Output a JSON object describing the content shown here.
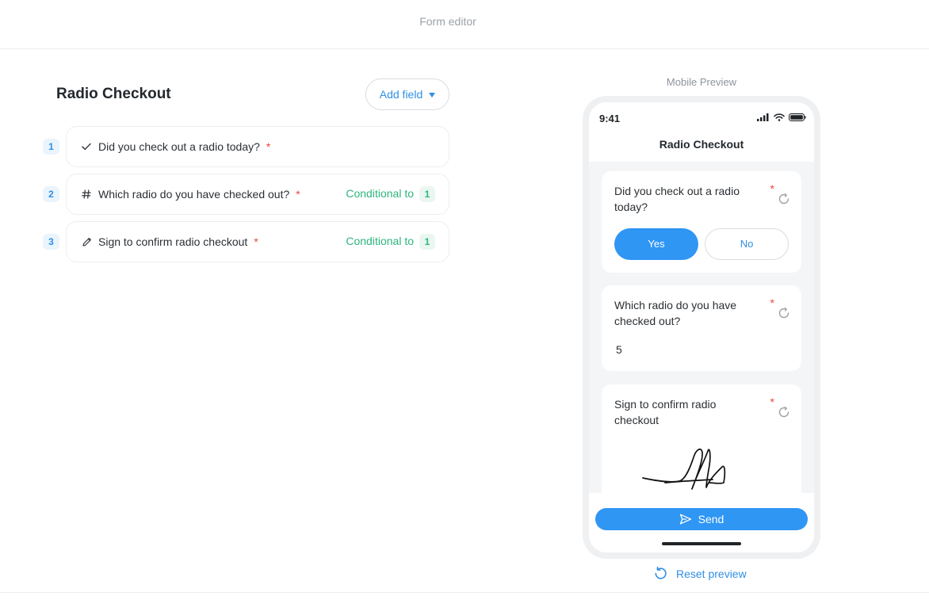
{
  "header": {
    "title": "Form editor"
  },
  "editor": {
    "form_title": "Radio Checkout",
    "add_field_label": "Add field",
    "fields": [
      {
        "number": "1",
        "icon": "check-icon",
        "label": "Did you check out a radio today?",
        "required": "*",
        "conditional_label": "",
        "conditional_to": ""
      },
      {
        "number": "2",
        "icon": "hash-icon",
        "label": "Which radio do you have checked out?",
        "required": "*",
        "conditional_label": "Conditional to",
        "conditional_to": "1"
      },
      {
        "number": "3",
        "icon": "pencil-icon",
        "label": "Sign to confirm radio checkout",
        "required": "*",
        "conditional_label": "Conditional to",
        "conditional_to": "1"
      }
    ]
  },
  "preview": {
    "label": "Mobile Preview",
    "status_time": "9:41",
    "app_title": "Radio Checkout",
    "q1": {
      "text": "Did you check out a radio today?",
      "required": "*",
      "yes": "Yes",
      "no": "No",
      "selected": "Yes"
    },
    "q2": {
      "text": "Which radio do you have checked out?",
      "required": "*",
      "answer": "5"
    },
    "q3": {
      "text": "Sign to confirm radio checkout",
      "required": "*"
    },
    "send_label": "Send",
    "reset_label": "Reset preview"
  },
  "colors": {
    "accent": "#2f96f4",
    "success": "#2eb67d",
    "required": "#e8453c"
  }
}
